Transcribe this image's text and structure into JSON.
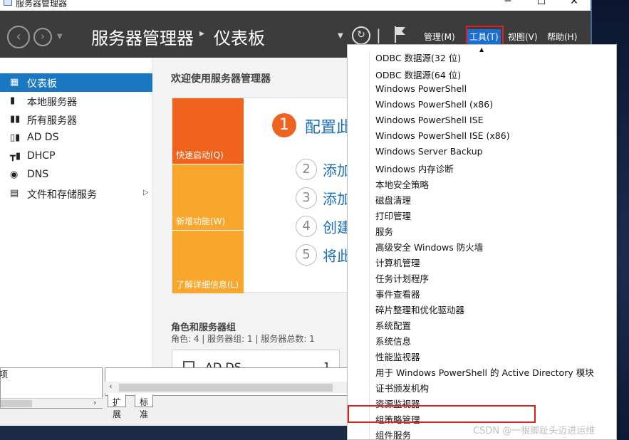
{
  "window": {
    "title": "服务器管理器",
    "min_glyph": "─",
    "max_glyph": "☐",
    "close_glyph": "✕"
  },
  "header": {
    "app_name": "服务器管理器",
    "separator": "▸",
    "page_name": "仪表板",
    "menus": [
      {
        "label": "管理(M)",
        "active": false
      },
      {
        "label": "工具(T)",
        "active": true
      },
      {
        "label": "视图(V)",
        "active": false
      },
      {
        "label": "帮助(H)",
        "active": false
      }
    ]
  },
  "leftnav": {
    "items": [
      {
        "label": "仪表板",
        "icon": "dashboard-icon",
        "selected": true
      },
      {
        "label": "本地服务器",
        "icon": "server-icon",
        "selected": false
      },
      {
        "label": "所有服务器",
        "icon": "servers-icon",
        "selected": false
      },
      {
        "label": "AD DS",
        "icon": "ad-ds-icon",
        "selected": false
      },
      {
        "label": "DHCP",
        "icon": "dhcp-icon",
        "selected": false
      },
      {
        "label": "DNS",
        "icon": "dns-icon",
        "selected": false
      },
      {
        "label": "文件和存储服务",
        "icon": "file-storage-icon",
        "selected": false,
        "has_arrow": true
      }
    ]
  },
  "main": {
    "welcome_title": "欢迎使用服务器管理器",
    "tiles": [
      "快速启动(Q)",
      "新增功能(W)",
      "了解详细信息(L)"
    ],
    "steps": [
      {
        "num": "1",
        "text": "配置此"
      },
      {
        "num": "2",
        "text": "添加"
      },
      {
        "num": "3",
        "text": "添加"
      },
      {
        "num": "4",
        "text": "创建"
      },
      {
        "num": "5",
        "text": "将此"
      }
    ],
    "roles_title": "角色和服务器组",
    "roles_sub": "角色: 4 | 服务器组: 1 | 服务器总数: 1",
    "role_card": {
      "name": "AD DS",
      "count": "1"
    }
  },
  "bottom": {
    "left_text": "项",
    "tabs": [
      "扩展",
      "标准"
    ]
  },
  "tools_menu": {
    "items": [
      "ODBC 数据源(32 位)",
      "ODBC 数据源(64 位)",
      "Windows PowerShell",
      "Windows PowerShell (x86)",
      "Windows PowerShell ISE",
      "Windows PowerShell ISE (x86)",
      "Windows Server Backup",
      "Windows 内存诊断",
      "本地安全策略",
      "磁盘清理",
      "打印管理",
      "服务",
      "高级安全 Windows 防火墙",
      "计算机管理",
      "任务计划程序",
      "事件查看器",
      "碎片整理和优化驱动器",
      "系统配置",
      "系统信息",
      "性能监视器",
      "用于 Windows PowerShell 的 Active Directory 模块",
      "证书颁发机构",
      "资源监视器",
      "组策略管理",
      "组件服务"
    ],
    "highlighted": "组策略管理"
  },
  "watermark": "CSDN @一根脚趾头迈进运维",
  "colors": {
    "header_bg": "#3c3c3c",
    "nav_selected": "#1a78c2",
    "tile_primary": "#f0631f",
    "tile_secondary": "#f8a72c",
    "highlight_box": "#e02020"
  }
}
